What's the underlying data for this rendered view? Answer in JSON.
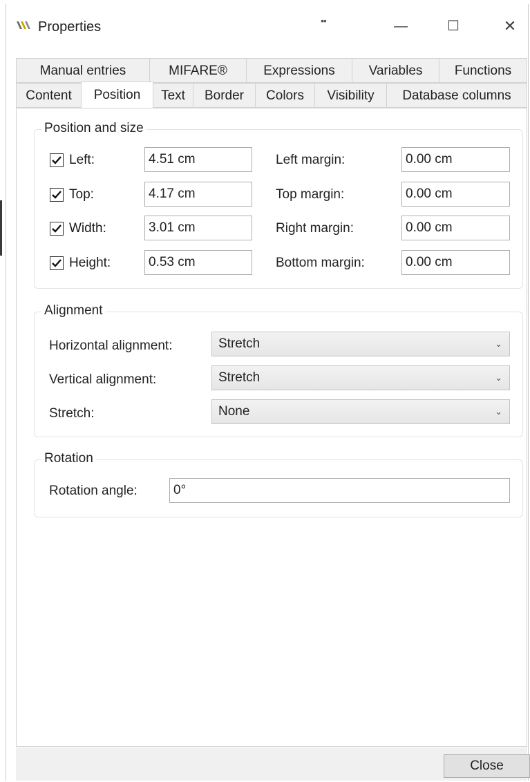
{
  "window": {
    "title": "Properties",
    "drag_mark": "••",
    "controls": {
      "minimize": "—",
      "maximize": "☐",
      "close": "✕"
    }
  },
  "tabs": {
    "back_row": [
      {
        "label": "Manual entries"
      },
      {
        "label": "MIFARE®"
      },
      {
        "label": "Expressions"
      },
      {
        "label": "Variables"
      },
      {
        "label": "Functions"
      }
    ],
    "front_row": [
      {
        "label": "Content"
      },
      {
        "label": "Position",
        "active": true
      },
      {
        "label": "Text"
      },
      {
        "label": "Border"
      },
      {
        "label": "Colors"
      },
      {
        "label": "Visibility"
      },
      {
        "label": "Database columns"
      }
    ]
  },
  "position_size": {
    "title": "Position and size",
    "left": {
      "label": "Left:",
      "checked": true,
      "value": "4.51 cm"
    },
    "top": {
      "label": "Top:",
      "checked": true,
      "value": "4.17 cm"
    },
    "width": {
      "label": "Width:",
      "checked": true,
      "value": "3.01 cm"
    },
    "height": {
      "label": "Height:",
      "checked": true,
      "value": "0.53 cm"
    },
    "left_margin": {
      "label": "Left margin:",
      "value": "0.00 cm"
    },
    "top_margin": {
      "label": "Top margin:",
      "value": "0.00 cm"
    },
    "right_margin": {
      "label": "Right margin:",
      "value": "0.00 cm"
    },
    "bottom_margin": {
      "label": "Bottom margin:",
      "value": "0.00 cm"
    }
  },
  "alignment": {
    "title": "Alignment",
    "horizontal": {
      "label": "Horizontal alignment:",
      "value": "Stretch"
    },
    "vertical": {
      "label": "Vertical alignment:",
      "value": "Stretch"
    },
    "stretch": {
      "label": "Stretch:",
      "value": "None"
    }
  },
  "rotation": {
    "title": "Rotation",
    "angle": {
      "label": "Rotation angle:",
      "value": "0°"
    }
  },
  "footer": {
    "close_label": "Close"
  },
  "icons": {
    "app": "app-logo-icon",
    "check": "checkmark-icon",
    "dropdown": "chevron-down-icon"
  }
}
